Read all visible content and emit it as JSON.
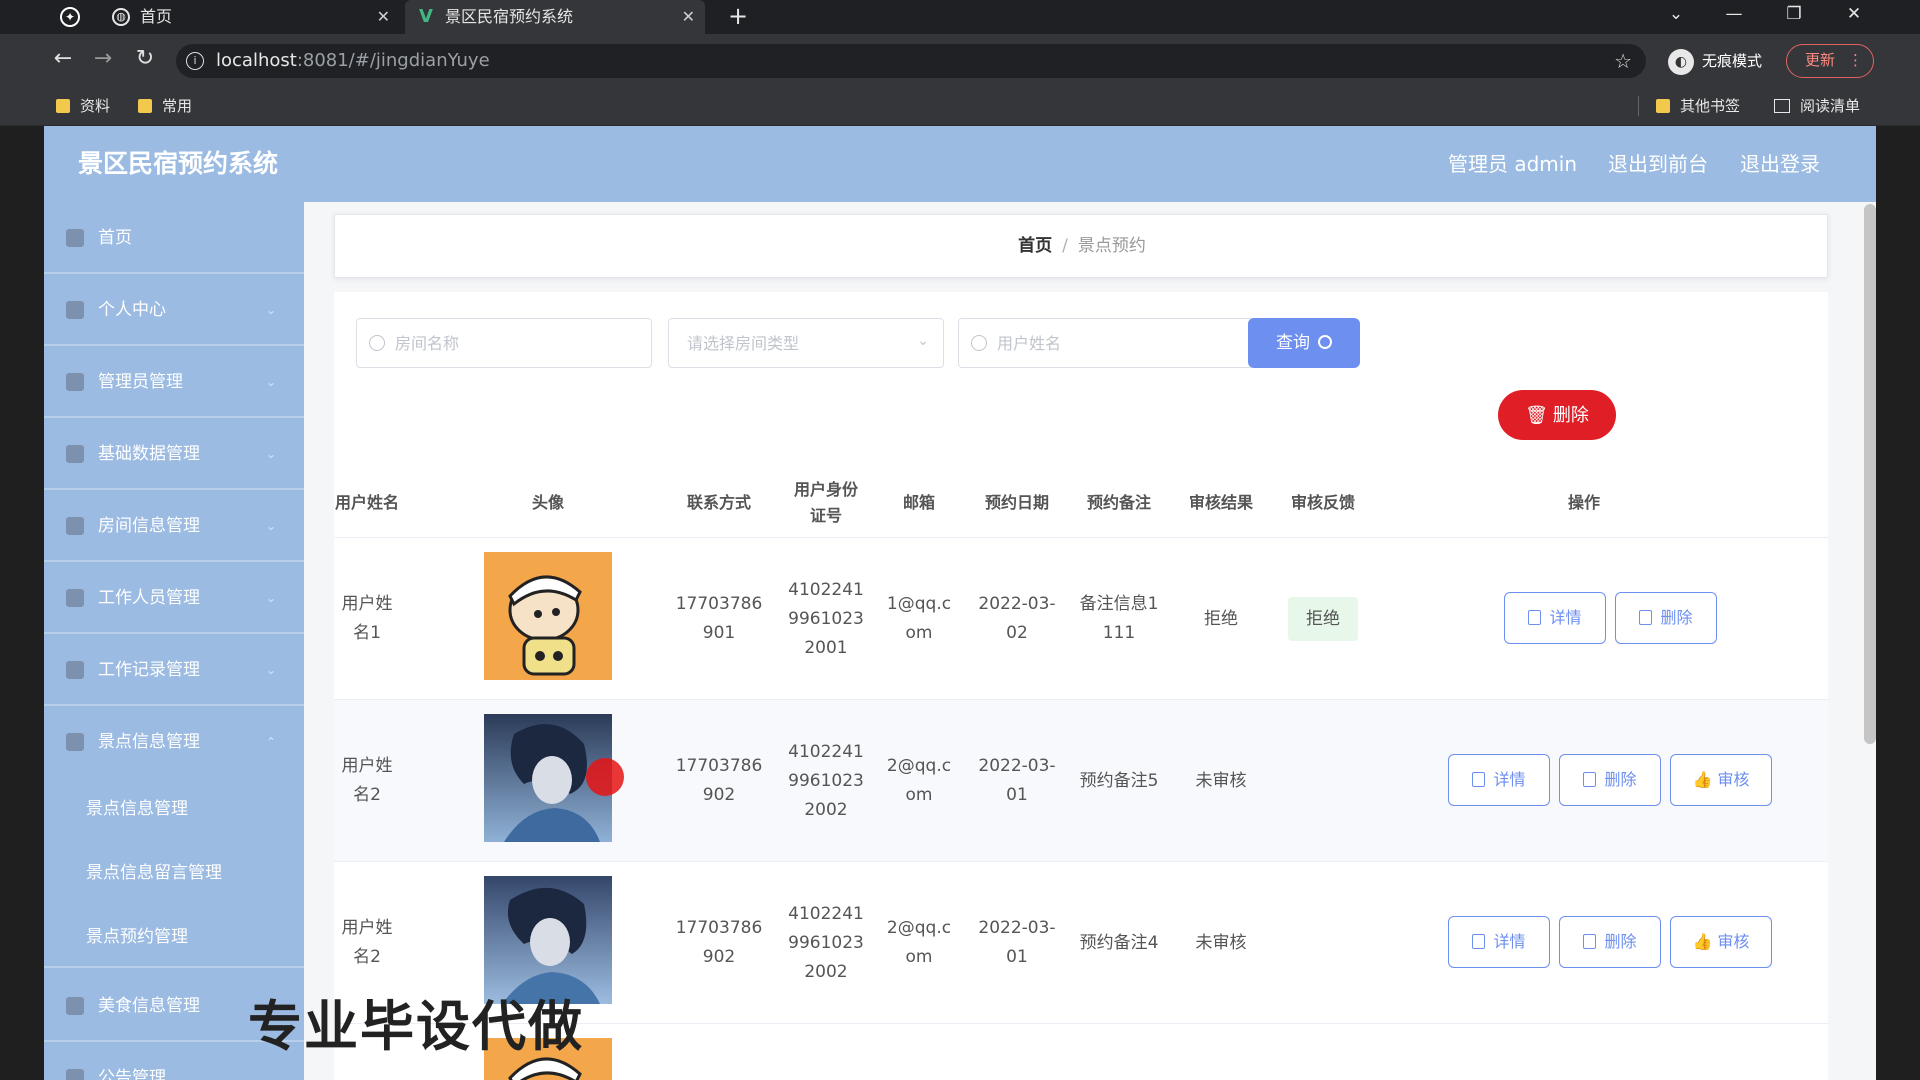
{
  "browser": {
    "tabs": [
      {
        "title": "首页",
        "active": false
      },
      {
        "title": "景区民宿预约系统",
        "active": true
      }
    ],
    "url_host": "localhost",
    "url_path": ":8081/#/jingdianYuye",
    "incognito_label": "无痕模式",
    "update_label": "更新",
    "bookmarks": [
      "资料",
      "常用"
    ],
    "bookmarks_right": [
      "其他书签",
      "阅读清单"
    ]
  },
  "header": {
    "brand": "景区民宿预约系统",
    "links": [
      "管理员 admin",
      "退出到前台",
      "退出登录"
    ]
  },
  "sidebar": {
    "items": [
      {
        "label": "首页"
      },
      {
        "label": "个人中心"
      },
      {
        "label": "管理员管理"
      },
      {
        "label": "基础数据管理"
      },
      {
        "label": "房间信息管理"
      },
      {
        "label": "工作人员管理"
      },
      {
        "label": "工作记录管理"
      },
      {
        "label": "景点信息管理"
      }
    ],
    "sub_items": [
      {
        "label": "景点信息管理"
      },
      {
        "label": "景点信息留言管理"
      },
      {
        "label": "景点预约管理"
      }
    ],
    "after_items": [
      {
        "label": "美食信息管理"
      },
      {
        "label": "公告管理"
      }
    ]
  },
  "breadcrumb": {
    "home": "首页",
    "current": "景点预约"
  },
  "search": {
    "room_name_placeholder": "房间名称",
    "room_type_placeholder": "请选择房间类型",
    "user_name_placeholder": "用户姓名",
    "query_label": "查询",
    "delete_label": "删除"
  },
  "table": {
    "headers": [
      "用户姓名",
      "头像",
      "联系方式",
      "用户身份证号",
      "邮箱",
      "预约日期",
      "预约备注",
      "审核结果",
      "审核反馈",
      "操作"
    ],
    "rows": [
      {
        "name": "用户姓名1",
        "phone": "17703786901",
        "id": "410224199610232001",
        "email": "1@qq.com",
        "date": "2022-03-02",
        "note": "备注信息1111",
        "result": "拒绝",
        "feedback": "拒绝",
        "actions": [
          "详情",
          "删除"
        ]
      },
      {
        "name": "用户姓名2",
        "phone": "17703786902",
        "id": "410224199610232002",
        "email": "2@qq.com",
        "date": "2022-03-01",
        "note": "预约备注5",
        "result": "未审核",
        "feedback": "",
        "actions": [
          "详情",
          "删除",
          "审核"
        ]
      },
      {
        "name": "用户姓名2",
        "phone": "17703786902",
        "id": "410224199610232002",
        "email": "2@qq.com",
        "date": "2022-03-01",
        "note": "预约备注4",
        "result": "未审核",
        "feedback": "",
        "actions": [
          "详情",
          "删除",
          "审核"
        ]
      }
    ]
  },
  "watermark": "专业毕设代做",
  "colors": {
    "sidebar_bg": "#9bbbe3",
    "accent": "#6c8ff0",
    "danger": "#e01e26",
    "tag_bg": "#e7f7ea"
  }
}
